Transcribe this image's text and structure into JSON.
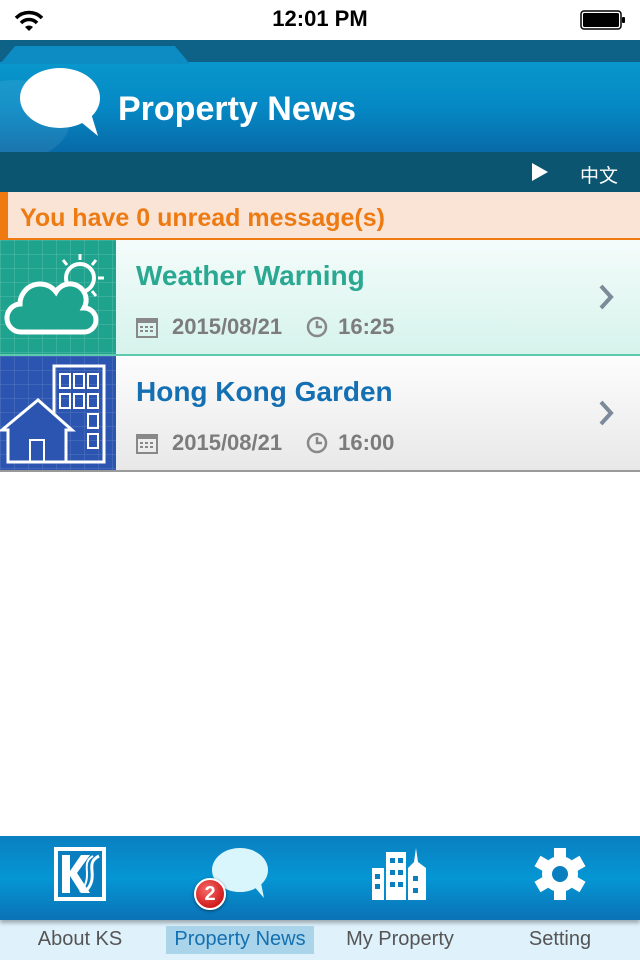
{
  "status_bar": {
    "time": "12:01 PM",
    "wifi_icon": "wifi-icon",
    "battery_icon": "battery-icon"
  },
  "header": {
    "title": "Property News",
    "icon": "speech-bubble-icon"
  },
  "subbar": {
    "play_icon": "play-icon",
    "language_label": "中文"
  },
  "unread_banner": {
    "text": "You have 0 unread message(s)",
    "accent_color": "#ee7a12"
  },
  "news_items": [
    {
      "title": "Weather Warning",
      "date": "2015/08/21",
      "time": "16:25",
      "thumbnail_icon": "weather-cloud-sun-icon",
      "title_color": "#2aa891"
    },
    {
      "title": "Hong Kong Garden",
      "date": "2015/08/21",
      "time": "16:00",
      "thumbnail_icon": "house-building-icon",
      "title_color": "#1470b2"
    }
  ],
  "tabbar": {
    "tabs": [
      {
        "label": "About KS",
        "icon": "ks-logo-icon",
        "active": false
      },
      {
        "label": "Property News",
        "icon": "speech-bubble-icon",
        "active": true,
        "badge": "2"
      },
      {
        "label": "My Property",
        "icon": "buildings-icon",
        "active": false
      },
      {
        "label": "Setting",
        "icon": "gear-icon",
        "active": false
      }
    ]
  }
}
